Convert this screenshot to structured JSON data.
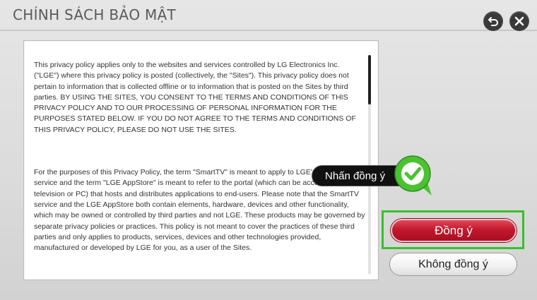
{
  "header": {
    "title": "CHÍNH SÁCH BẢO MẬT",
    "back_icon": "back-arrow-icon",
    "close_icon": "close-icon"
  },
  "policy": {
    "paragraph_1": "This privacy policy applies only to the websites and services controlled by LG Electronics Inc. (\"LGE\") where this privacy policy is posted (collectively, the \"Sites\"). This privacy policy does not pertain to information that is collected offline or to information that is posted on the Sites by third parties. BY USING THE SITES, YOU CONSENT TO THE TERMS AND CONDITIONS OF THIS PRIVACY POLICY AND TO OUR PROCESSING OF PERSONAL INFORMATION FOR THE PURPOSES STATED BELOW. IF YOU DO NOT AGREE TO THE TERMS AND CONDITIONS OF THIS PRIVACY POLICY, PLEASE DO NOT USE THE SITES.",
    "paragraph_2": "For the purposes of this Privacy Policy, the term \"SmartTV\" is meant to apply to LGE's SmartTV service and the term \"LGE AppStore\" is meant to refer to the portal (which can be accessed via your television or PC) that hosts and distributes applications to end-users. Please note that the SmartTV service and the LGE AppStore both contain elements, hardware, devices and other functionality, which may be owned or controlled by third parties and not LGE. These products may be governed by separate privacy policies or practices. This policy is not meant to cover the practices of these third parties and only applies to products, services, devices and other technologies provided, manufactured or developed by LGE for you, as a user of the Sites."
  },
  "callout": {
    "text": "Nhấn đồng ý",
    "icon": "check-icon"
  },
  "actions": {
    "agree_label": "Đồng ý",
    "disagree_label": "Không đồng ý"
  },
  "colors": {
    "agree_red": "#c2182d",
    "highlight_green": "#37c02a",
    "check_green": "#4cc233"
  }
}
